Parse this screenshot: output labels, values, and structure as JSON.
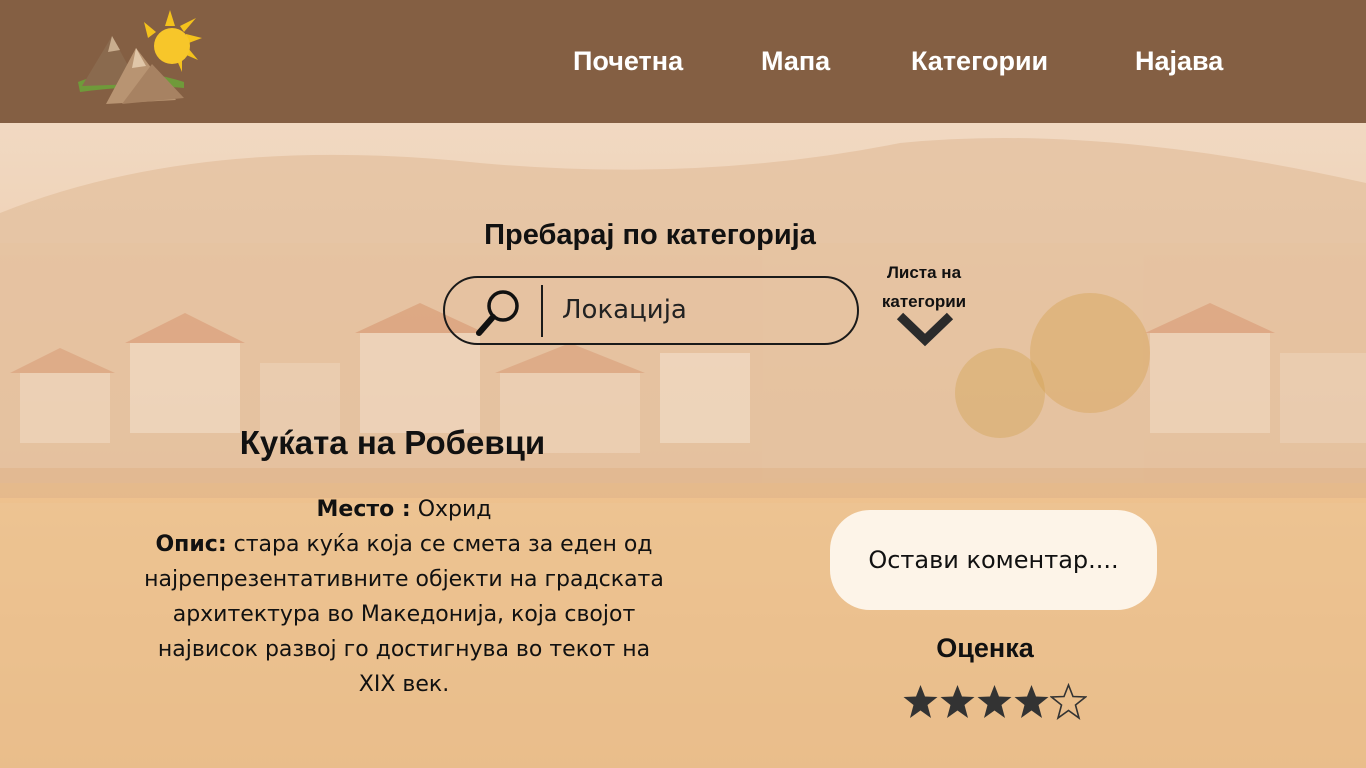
{
  "header": {
    "nav": [
      {
        "label": "Почетна"
      },
      {
        "label": "Мапа"
      },
      {
        "label": "Категории"
      },
      {
        "label": "Најава"
      }
    ]
  },
  "search": {
    "title": "Пребарај по категорија",
    "placeholder": "Локација",
    "category_list_label": "Листа на категории"
  },
  "place": {
    "title": "Куќата на Робевци",
    "location_label": "Место :",
    "location_value": "Охрид",
    "description_label": "Опис:",
    "description_value": "стара куќа  која се смета за еден од најрепрезентативните објекти на градската архитектура во Македонија, која својот највисок развој го достигнува во текот на XIX век."
  },
  "comment": {
    "placeholder": "Остави коментар...."
  },
  "rating": {
    "label": "Оценка",
    "value": 4,
    "max": 5
  },
  "colors": {
    "header_bg": "#845f43",
    "comment_bg": "#fdf4e8",
    "star_fill": "#333333"
  },
  "icons": {
    "logo": "mountain-sun-logo",
    "search": "search-icon",
    "dropdown": "chevron-down-icon",
    "star": "star-icon"
  }
}
